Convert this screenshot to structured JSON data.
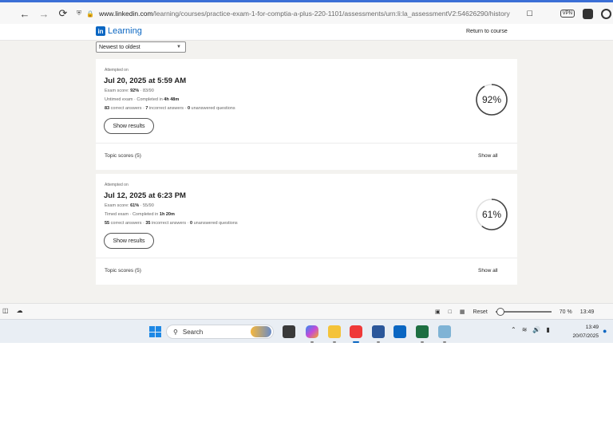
{
  "browser": {
    "url_host": "www.linkedin.com",
    "url_path": "/learning/courses/practice-exam-1-for-comptia-a-plus-220-1101/assessments/urn:li:la_assessmentV2:54626290/history",
    "vpn_label": "VPN"
  },
  "header": {
    "logo_in": "in",
    "logo_text": "Learning",
    "return_link": "Return to course"
  },
  "sort": {
    "selected": "Newest to oldest"
  },
  "attempts": [
    {
      "attempted_label": "Attempted on",
      "date": "Jul 20, 2025 at 5:59 AM",
      "exam_score_label": "Exam score: ",
      "exam_score_pct": "92%",
      "exam_score_frac": " · 83/90",
      "exam_type": "Untimed exam",
      "completed_label": " · Completed in ",
      "completed_time": "4h 48m",
      "correct": "83",
      "correct_label": " correct answers · ",
      "incorrect": "7",
      "incorrect_label": " incorrect answers · ",
      "unanswered": "0",
      "unanswered_label": " unanswered questions",
      "show_results": "Show results",
      "score_display": "92%",
      "score_value": 92,
      "topic_scores": "Topic scores (5)",
      "show_all": "Show all"
    },
    {
      "attempted_label": "Attempted on",
      "date": "Jul 12, 2025 at 6:23 PM",
      "exam_score_label": "Exam score: ",
      "exam_score_pct": "61%",
      "exam_score_frac": " · 55/90",
      "exam_type": "Timed exam",
      "completed_label": " · Completed in ",
      "completed_time": "1h 20m",
      "correct": "55",
      "correct_label": " correct answers · ",
      "incorrect": "35",
      "incorrect_label": " incorrect answers · ",
      "unanswered": "0",
      "unanswered_label": " unanswered questions",
      "show_results": "Show results",
      "score_display": "61%",
      "score_value": 61,
      "topic_scores": "Topic scores (5)",
      "show_all": "Show all"
    }
  ],
  "statusbar": {
    "reset_label": "Reset",
    "zoom_text": "70 %",
    "zoom_value": 70,
    "time_cut": "13:49"
  },
  "taskbar": {
    "search_placeholder": "Search",
    "time": "13:49",
    "date": "20/07/2025"
  },
  "colors": {
    "accent": "#0a66c2",
    "ring": "#444444",
    "page_bg": "#f3f2ef"
  }
}
